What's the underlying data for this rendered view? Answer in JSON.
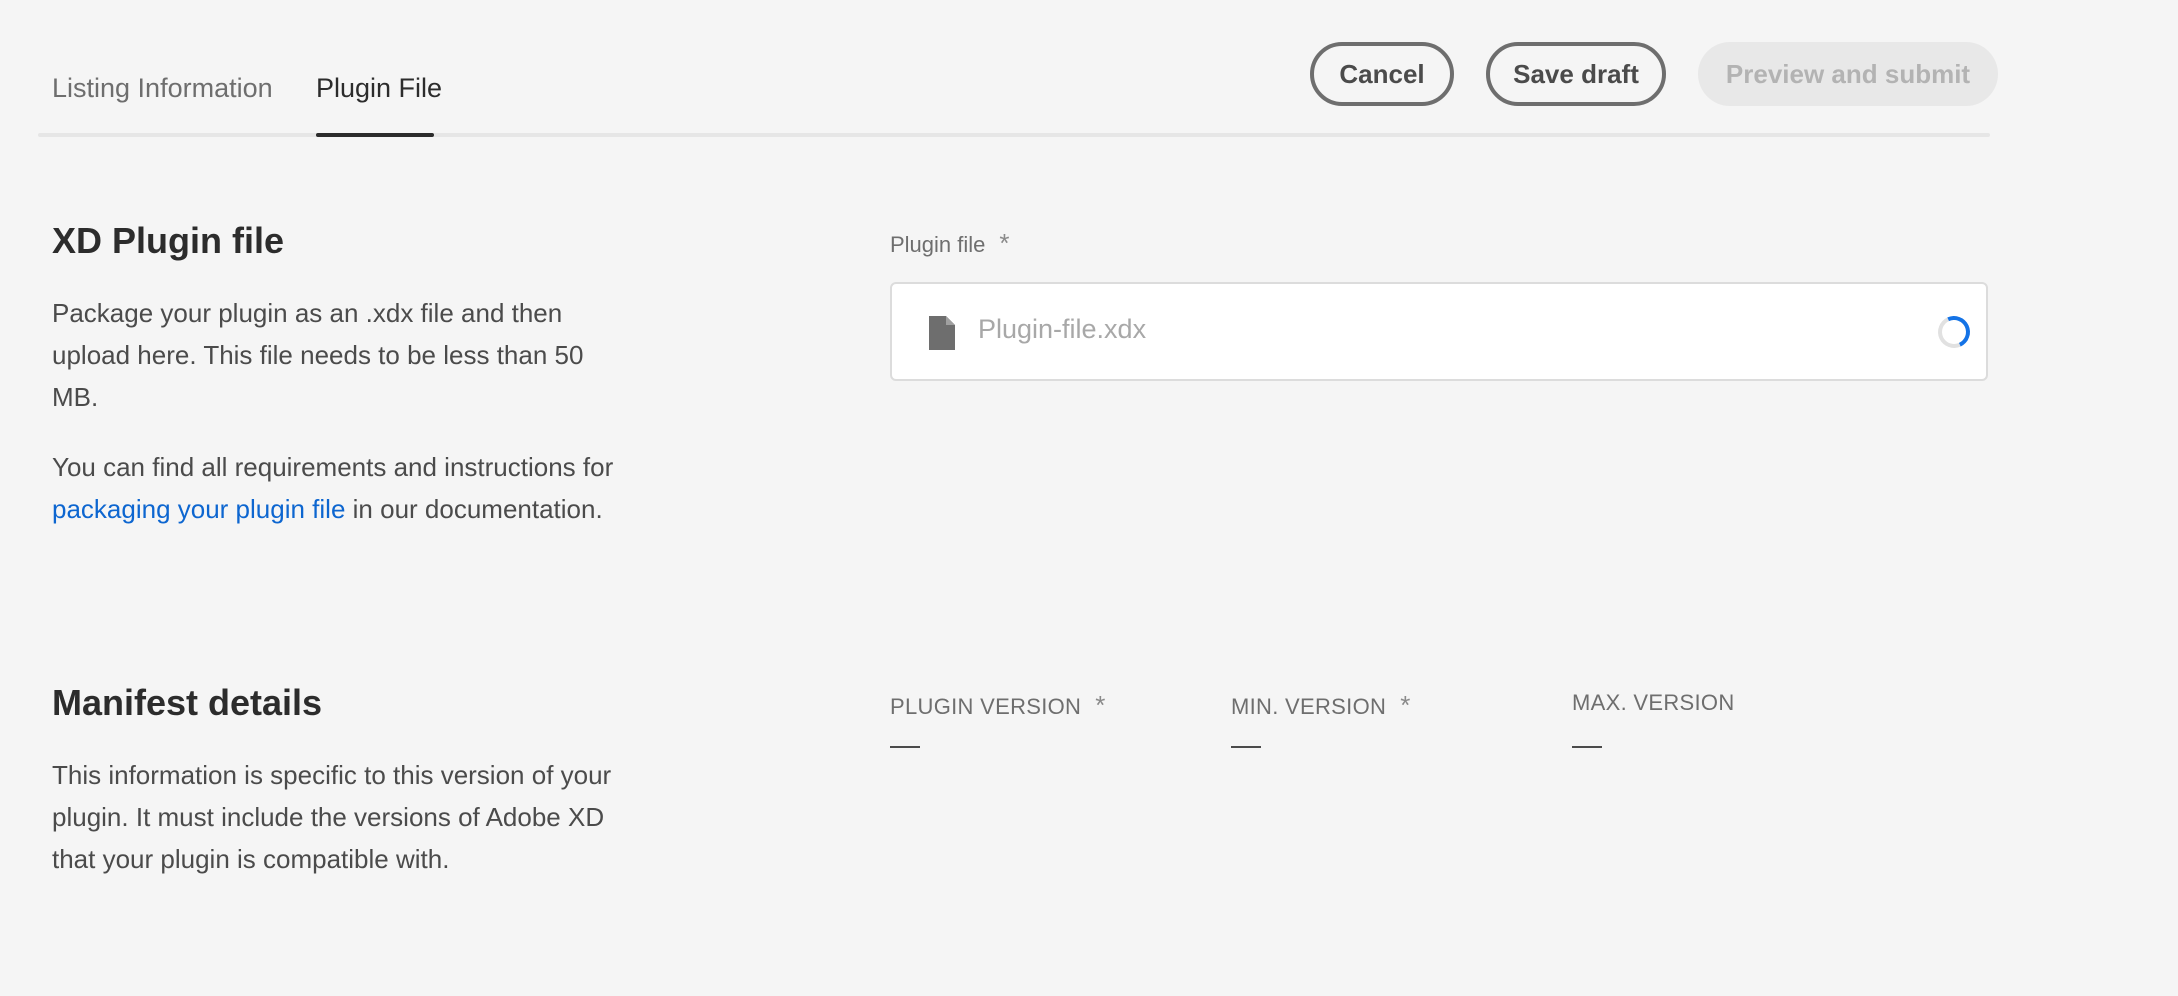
{
  "tabs": [
    {
      "label": "Listing Information",
      "active": false
    },
    {
      "label": "Plugin File",
      "active": true
    }
  ],
  "actions": {
    "cancel_label": "Cancel",
    "save_draft_label": "Save draft",
    "preview_submit_label": "Preview and submit",
    "preview_submit_disabled": true
  },
  "plugin_section": {
    "title": "XD Plugin file",
    "description": "Package your plugin as an .xdx file and then upload here. This file needs to be less than 50 MB.",
    "requirements_before": "You can find all requirements and instructions for ",
    "requirements_link": "packaging your plugin file",
    "requirements_after": " in our documentation.",
    "field_label": "Plugin file",
    "required_mark": "*",
    "file_name": "Plugin-file.xdx",
    "file_icon": "document-icon",
    "upload_state_icon": "spinner-icon"
  },
  "manifest_section": {
    "title": "Manifest details",
    "description": "This information is specific to this version of your plugin. It must include the versions of Adobe XD that your plugin is compatible with.",
    "plugin_version_label": "PLUGIN VERSION",
    "min_version_label": "MIN. VERSION",
    "max_version_label": "MAX. VERSION",
    "required_mark": "*"
  },
  "colors": {
    "background": "#f5f5f5",
    "link": "#0d66d0",
    "spinner": "#1473e6",
    "active_tab": "#2c2c2c"
  }
}
